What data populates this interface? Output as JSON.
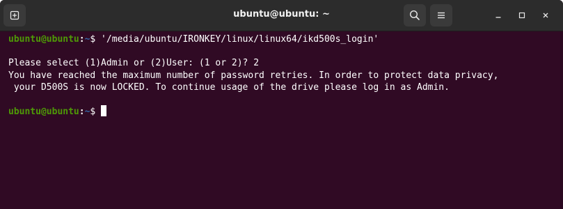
{
  "window": {
    "title": "ubuntu@ubuntu: ~",
    "colors": {
      "terminal_background": "#300a24",
      "titlebar_background": "#2c2c2c",
      "prompt_user_color": "#4e9a06",
      "prompt_path_color": "#3465a4",
      "text_color": "#ffffff"
    },
    "icons": {
      "new_tab": "new-tab-icon",
      "search": "search-icon",
      "menu": "hamburger-menu-icon",
      "minimize": "minimize-icon",
      "maximize": "maximize-icon",
      "close": "close-icon"
    }
  },
  "terminal": {
    "prompt1": {
      "user_host": "ubuntu@ubuntu",
      "separator": ":",
      "path": "~",
      "symbol": "$",
      "command": " '/media/ubuntu/IRONKEY/linux/linux64/ikd500s_login'"
    },
    "output": [
      "Please select (1)Admin or (2)User: (1 or 2)? 2",
      "You have reached the maximum number of password retries. In order to protect data privacy,",
      " your D500S is now LOCKED. To continue usage of the drive please log in as Admin."
    ],
    "prompt2": {
      "user_host": "ubuntu@ubuntu",
      "separator": ":",
      "path": "~",
      "symbol": "$"
    }
  }
}
